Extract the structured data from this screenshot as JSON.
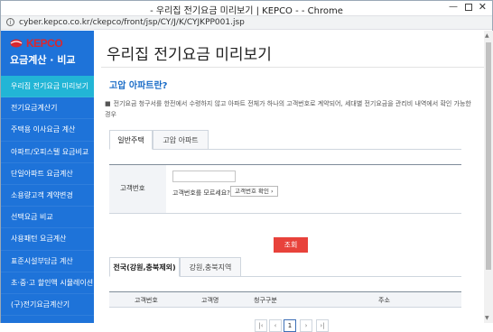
{
  "window": {
    "title": "- 우리집 전기요금 미리보기 | KEPCO - - Chrome",
    "minimize_glyph": "—",
    "close_glyph": "✕"
  },
  "address": {
    "url": "cyber.kepco.co.kr/ckepco/front/jsp/CY/J/K/CYJKPP001.jsp",
    "lock_glyph": "i"
  },
  "sidebar": {
    "logo_text": "KEPCO",
    "subtitle": "요금계산 · 비교",
    "items": [
      {
        "label": "우리집 전기요금 미리보기",
        "active": true
      },
      {
        "label": "전기요금계산기",
        "active": false
      },
      {
        "label": "주택용 이사요금 계산",
        "active": false
      },
      {
        "label": "아파트/오피스텔 요금비교",
        "active": false
      },
      {
        "label": "단일아파트 요금계산",
        "active": false
      },
      {
        "label": "소용량고객 계약변경",
        "active": false
      },
      {
        "label": "선택요금 비교",
        "active": false
      },
      {
        "label": "사용패턴 요금계산",
        "active": false
      },
      {
        "label": "표준시설부담금 계산",
        "active": false
      },
      {
        "label": "초·중·고 할인액 시뮬레이션",
        "active": false
      },
      {
        "label": "(구)전기요금계산기",
        "active": false
      }
    ]
  },
  "main": {
    "page_title": "우리집 전기요금 미리보기",
    "section_title": "고압 아파트란?",
    "description_bullet": "■",
    "description": "전기요금 청구서를 한전에서 수령하지 않고 아파트 전체가 하나의 고객번호로 계약되어, 세대별 전기요금을 관리비 내역에서 확인 가능한 경우",
    "tabs_top": [
      {
        "label": "일반주택",
        "active": true
      },
      {
        "label": "고압 아파트",
        "active": false
      }
    ],
    "form": {
      "label": "고객번호",
      "input_value": "",
      "help_text": "고객번호를 모르세요?",
      "help_button": "고객번호 확인 ›"
    },
    "search_button": "조회",
    "tabs_bottom": [
      {
        "label": "전국(강원,충북제외)",
        "active": true
      },
      {
        "label": "강원,충북지역",
        "active": false
      }
    ],
    "table_headers": [
      "고객번호",
      "고객명",
      "청구구분",
      "주소"
    ],
    "pager": {
      "first": "|‹",
      "prev": "‹",
      "current": "1",
      "next": "›",
      "last": "›|"
    }
  },
  "colors": {
    "sidebar_bg": "#1e73d9",
    "sidebar_active": "#22b5d6",
    "section_title": "#1a6cc7",
    "search_button": "#e8423b",
    "logo_red": "#d9272e"
  }
}
